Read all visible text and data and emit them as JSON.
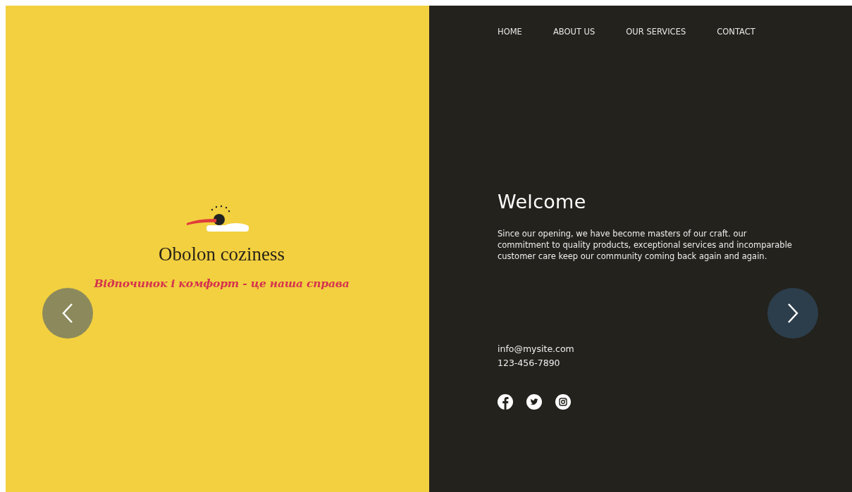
{
  "nav": [
    {
      "label": "HOME"
    },
    {
      "label": "ABOUT US"
    },
    {
      "label": "OUR SERVICES"
    },
    {
      "label": "CONTACT"
    }
  ],
  "brand": {
    "title": "Obolon coziness",
    "tagline": "Відпочинок і комфорт - це наша справа"
  },
  "welcome": {
    "heading": "Welcome",
    "text": "Since our opening, we have become masters of our craft. our commitment to quality products, exceptional services and incomparable customer care keep our community coming back again and again."
  },
  "contact": {
    "email": "info@mysite.com",
    "phone": "123-456-7890"
  },
  "social": [
    {
      "kind": "facebook"
    },
    {
      "kind": "twitter"
    },
    {
      "kind": "instagram"
    }
  ]
}
